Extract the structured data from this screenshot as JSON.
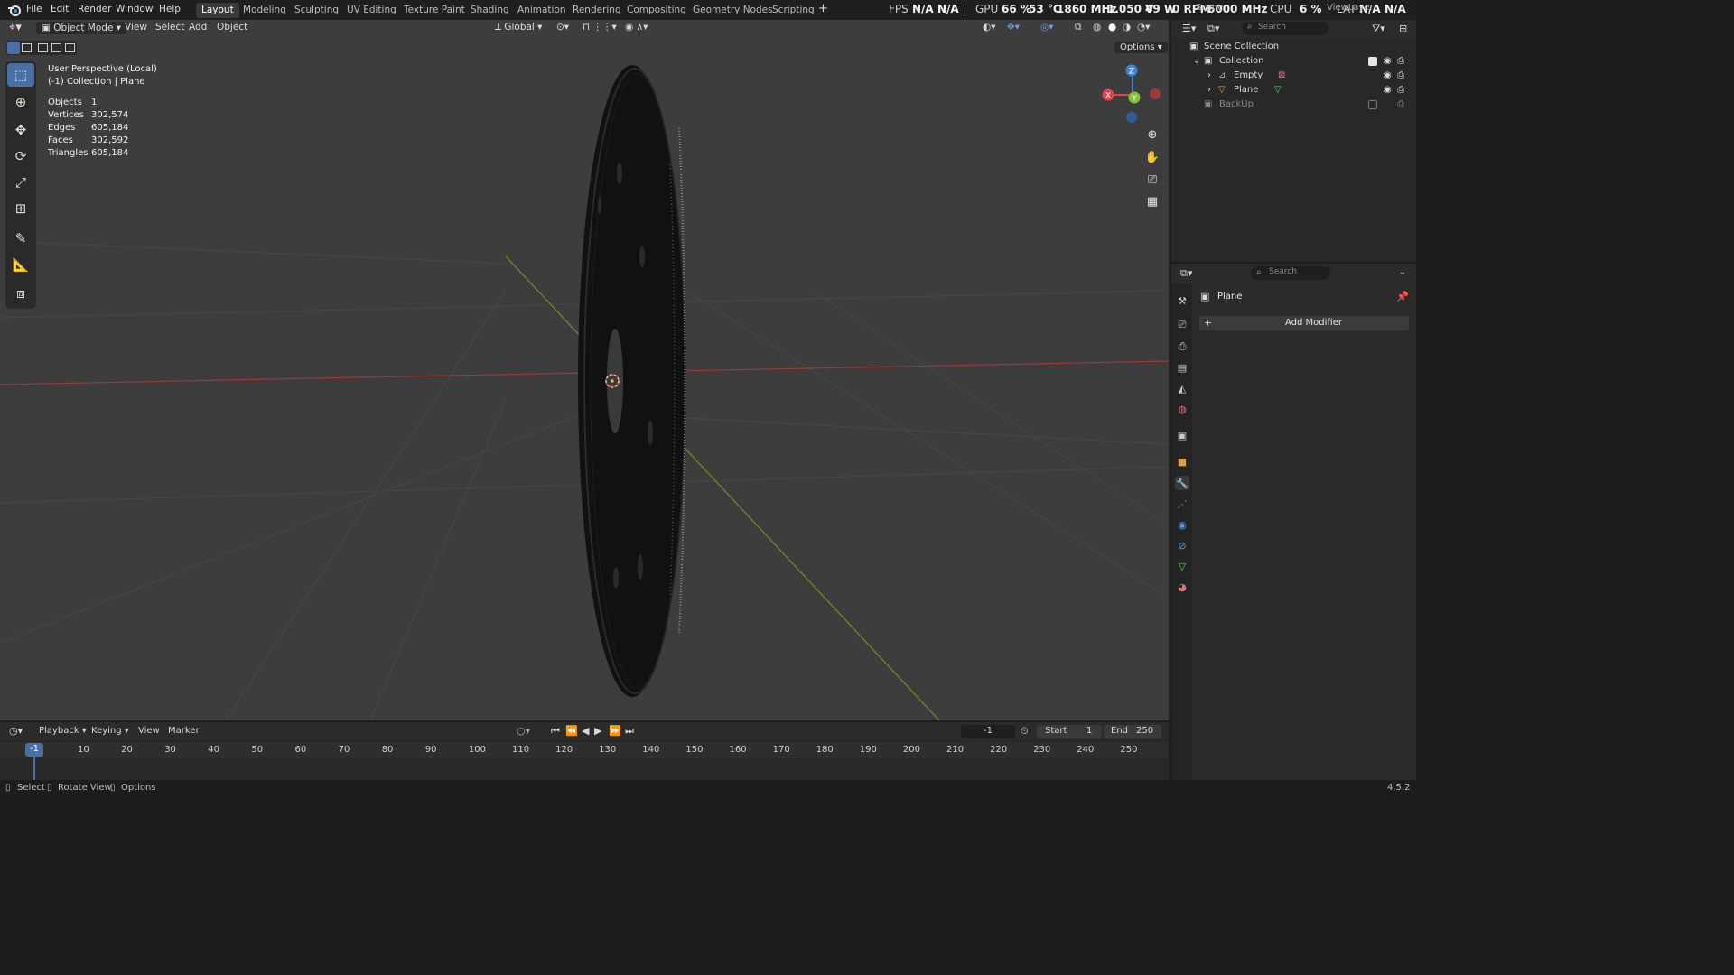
{
  "menu": [
    "File",
    "Edit",
    "Render",
    "Window",
    "Help"
  ],
  "workspaces": [
    {
      "label": "Layout",
      "active": true
    },
    {
      "label": "Modeling",
      "active": false
    },
    {
      "label": "Sculpting",
      "active": false
    },
    {
      "label": "UV Editing",
      "active": false
    },
    {
      "label": "Texture Paint",
      "active": false
    },
    {
      "label": "Shading",
      "active": false
    },
    {
      "label": "Animation",
      "active": false
    },
    {
      "label": "Rendering",
      "active": false
    },
    {
      "label": "Compositing",
      "active": false
    },
    {
      "label": "Geometry Nodes",
      "active": false
    },
    {
      "label": "Scripting",
      "active": false
    }
  ],
  "add_workspace_icon": "+",
  "hud": {
    "fps_label": "FPS",
    "fps_value": "N/A",
    "fps_value2": "N/A",
    "gpu_label": "GPU",
    "gpu_load": "66 %",
    "gpu_temp": "53 °C",
    "gpu_clock": "1860 MHz",
    "gpu_volt": "1.050 V",
    "gpu_power": "49 W",
    "gpu_fan": "0 RPM",
    "gpu_mem_clock": "6000 MHz",
    "cpu_label": "CPU",
    "cpu_load": "6 %",
    "lat_label": "LAT",
    "lat_value": "N/A",
    "lat_value2": "N/A"
  },
  "scene_field": "Scene",
  "viewlayer_field": "ViewLayer",
  "viewport_header": {
    "mode": "Object Mode",
    "view_menus": [
      "View",
      "Select",
      "Add",
      "Object"
    ],
    "transform": "Global",
    "options": "Options"
  },
  "viewport_info": {
    "perspective": "User Perspective (Local)",
    "collection": "(-1) Collection | Plane",
    "stats": [
      {
        "key": "Objects",
        "value": "1"
      },
      {
        "key": "Vertices",
        "value": "302,574"
      },
      {
        "key": "Edges",
        "value": "605,184"
      },
      {
        "key": "Faces",
        "value": "302,592"
      },
      {
        "key": "Triangles",
        "value": "605,184"
      }
    ]
  },
  "gizmo": {
    "x": "X",
    "y": "Y",
    "z": "Z"
  },
  "toolbar_icons": [
    "select-box-icon",
    "cursor-icon",
    "move-icon",
    "rotate-icon",
    "scale-icon",
    "transform-icon",
    "annotate-icon",
    "measure-icon",
    "add-cube-icon"
  ],
  "outliner": {
    "search_placeholder": "Search",
    "scene_collection": "Scene Collection",
    "collection": "Collection",
    "items": [
      "Empty",
      "Plane"
    ],
    "backup": "BackUp"
  },
  "properties": {
    "search_placeholder": "Search",
    "object_name": "Plane",
    "add_modifier": "Add Modifier"
  },
  "timeline": {
    "menus": [
      "Playback",
      "Keying",
      "View",
      "Marker"
    ],
    "current_frame": "-1",
    "start_label": "Start",
    "start_value": "1",
    "end_label": "End",
    "end_value": "250",
    "ticks": [
      "10",
      "20",
      "30",
      "40",
      "50",
      "60",
      "70",
      "80",
      "90",
      "100",
      "110",
      "120",
      "130",
      "140",
      "150",
      "160",
      "170",
      "180",
      "190",
      "200",
      "210",
      "220",
      "230",
      "240",
      "250"
    ]
  },
  "status": {
    "select": "Select",
    "rotate": "Rotate View",
    "options": "Options",
    "version": "4.5.2"
  },
  "colors": {
    "accent": "#4a6fa5",
    "x_axis": "#e0434c",
    "y_axis": "#8ac036",
    "z_axis": "#3f83d8",
    "active_tab": "#3a3a3a"
  }
}
